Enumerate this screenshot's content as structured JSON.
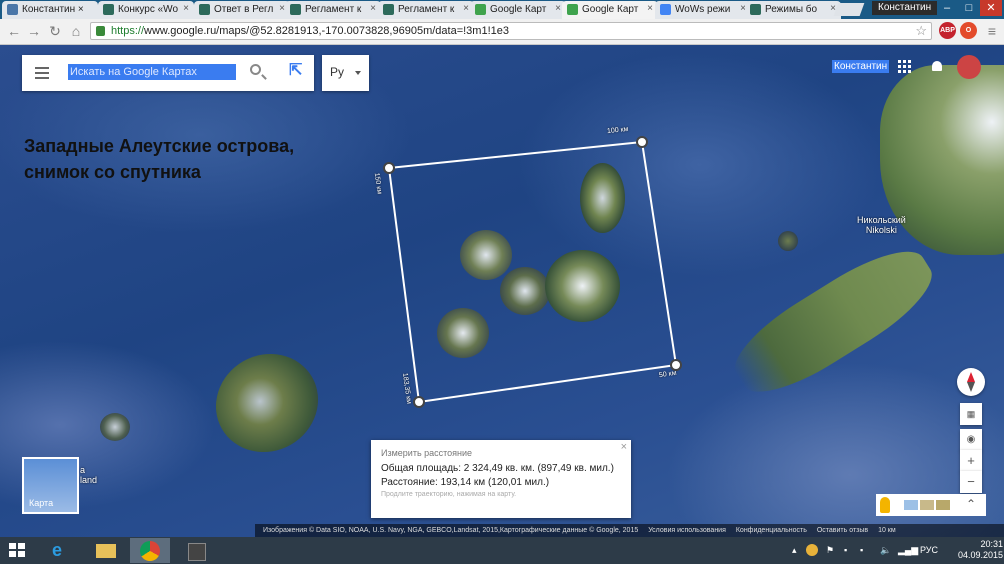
{
  "browser": {
    "tabs": [
      {
        "label": "Константин ×",
        "icon": "vk-icon",
        "color": "#4a76a8"
      },
      {
        "label": "Конкурс «Wo",
        "icon": "wows-icon",
        "color": "#2d6a5b"
      },
      {
        "label": "Ответ в Регл",
        "icon": "wows-icon",
        "color": "#2d6a5b"
      },
      {
        "label": "Регламент к",
        "icon": "wows-icon",
        "color": "#2d6a5b"
      },
      {
        "label": "Регламент к",
        "icon": "wows-icon",
        "color": "#2d6a5b"
      },
      {
        "label": "Google Карт",
        "icon": "google-maps-icon",
        "color": "#3fa34d"
      },
      {
        "label": "Google Карт",
        "icon": "google-maps-icon",
        "color": "#3fa34d"
      },
      {
        "label": "WoWs режи",
        "icon": "google-icon",
        "color": "#4285f4"
      },
      {
        "label": "Режимы бо",
        "icon": "wows-icon",
        "color": "#2d6a5b"
      }
    ],
    "user": "Константин",
    "window_controls": [
      "–",
      "□",
      "✕"
    ],
    "url_protocol": "https://",
    "url_rest": "www.google.ru/maps/@52.8281913,-170.0073828,96905m/data=!3m1!1e3",
    "extensions": [
      {
        "label": "ABP",
        "color": "#c4232e"
      },
      {
        "label": "O",
        "color": "#e34b2b"
      }
    ]
  },
  "maps": {
    "search_placeholder": "Искать на Google Картах",
    "language": "Ру",
    "user_name": "Константин",
    "caption_line1": "Западные Алеутские острова,",
    "caption_line2": "снимок со спутника",
    "place_label_ru": "Никольский",
    "place_label_en": "Nikolski",
    "island_label_line1": "a",
    "island_label_line2": "land",
    "scale_labels": {
      "top": "100 км",
      "left_top": "150 км",
      "right_bottom": "50 км",
      "left_bottom": "183,35 км"
    },
    "minimap_label": "Карта",
    "measure": {
      "title": "Измерить расстояние",
      "area": "Общая площадь: 2 324,49 кв. км. (897,49 кв. мил.)",
      "distance": "Расстояние: 193,14 км (120,01 мил.)",
      "hint": "Продлите траекторию, нажимая на карту.",
      "close": "×"
    },
    "controls": {
      "zoom_in": "+",
      "zoom_out": "−"
    },
    "attribution": "Изображения © Data SIO, NOAA, U.S. Navy, NGA, GEBCO,Landsat, 2015,Картографические данные © Google, 2015",
    "footer_links": [
      "Условия использования",
      "Конфиденциальность",
      "Оставить отзыв"
    ],
    "scale_bar": "10 км"
  },
  "taskbar": {
    "tray_lang": "РУС",
    "time": "20:31",
    "date": "04.09.2015"
  }
}
